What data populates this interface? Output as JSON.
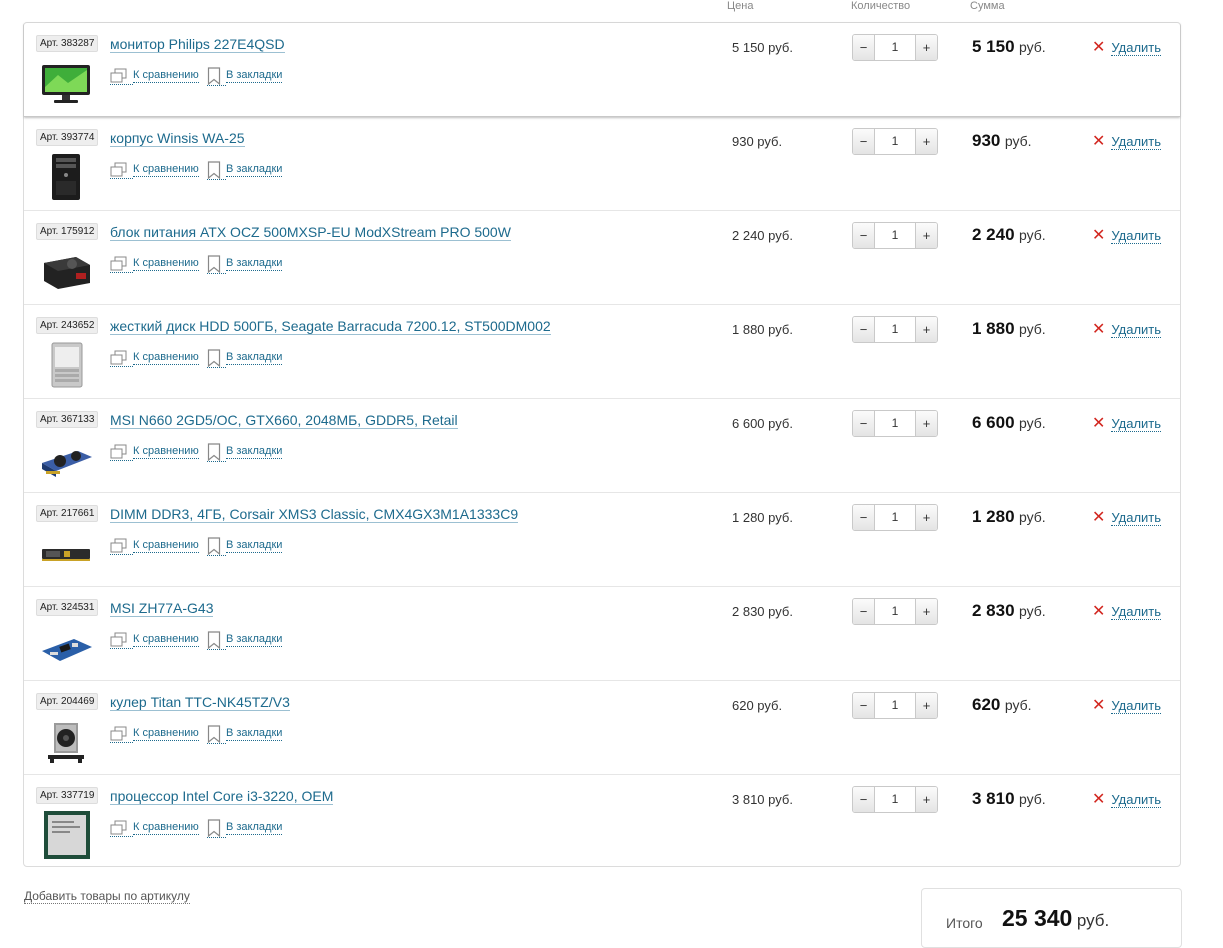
{
  "columns": {
    "price": "Цена",
    "quantity": "Количество",
    "sum": "Сумма"
  },
  "actions": {
    "compare": "К сравнению",
    "bookmark": "В закладки",
    "delete": "Удалить"
  },
  "currency": "руб.",
  "accent_color": "#1d6a8d",
  "delete_color": "#d2261f",
  "items": [
    {
      "art": "Арт. 383287",
      "name": "монитор Philips 227E4QSD",
      "price": "5 150 руб.",
      "qty": "1",
      "sum": "5 150",
      "icon": "monitor"
    },
    {
      "art": "Арт. 393774",
      "name": "корпус Winsis WA-25",
      "price": "930 руб.",
      "qty": "1",
      "sum": "930",
      "icon": "case"
    },
    {
      "art": "Арт. 175912",
      "name": "блок питания ATX OCZ 500MXSP-EU ModXStream PRO 500W",
      "price": "2 240 руб.",
      "qty": "1",
      "sum": "2 240",
      "icon": "psu"
    },
    {
      "art": "Арт. 243652",
      "name": "жесткий диск HDD 500ГБ, Seagate Barracuda 7200.12, ST500DM002",
      "price": "1 880 руб.",
      "qty": "1",
      "sum": "1 880",
      "icon": "hdd"
    },
    {
      "art": "Арт. 367133",
      "name": "MSI N660 2GD5/OC, GTX660, 2048МБ, GDDR5, Retail",
      "price": "6 600 руб.",
      "qty": "1",
      "sum": "6 600",
      "icon": "gpu"
    },
    {
      "art": "Арт. 217661",
      "name": "DIMM DDR3, 4ГБ, Corsair XMS3 Classic, CMX4GX3M1A1333C9",
      "price": "1 280 руб.",
      "qty": "1",
      "sum": "1 280",
      "icon": "ram"
    },
    {
      "art": "Арт. 324531",
      "name": "MSI ZH77A-G43",
      "price": "2 830 руб.",
      "qty": "1",
      "sum": "2 830",
      "icon": "motherboard"
    },
    {
      "art": "Арт. 204469",
      "name": "кулер Titan TTC-NK45TZ/V3",
      "price": "620 руб.",
      "qty": "1",
      "sum": "620",
      "icon": "cooler"
    },
    {
      "art": "Арт. 337719",
      "name": "процессор Intel Core i3-3220, OEM",
      "price": "3 810 руб.",
      "qty": "1",
      "sum": "3 810",
      "icon": "cpu"
    }
  ],
  "footer": {
    "add_by_article": "Добавить товары по артикулу",
    "total_label": "Итого",
    "total_value": "25 340",
    "total_currency": "руб."
  }
}
